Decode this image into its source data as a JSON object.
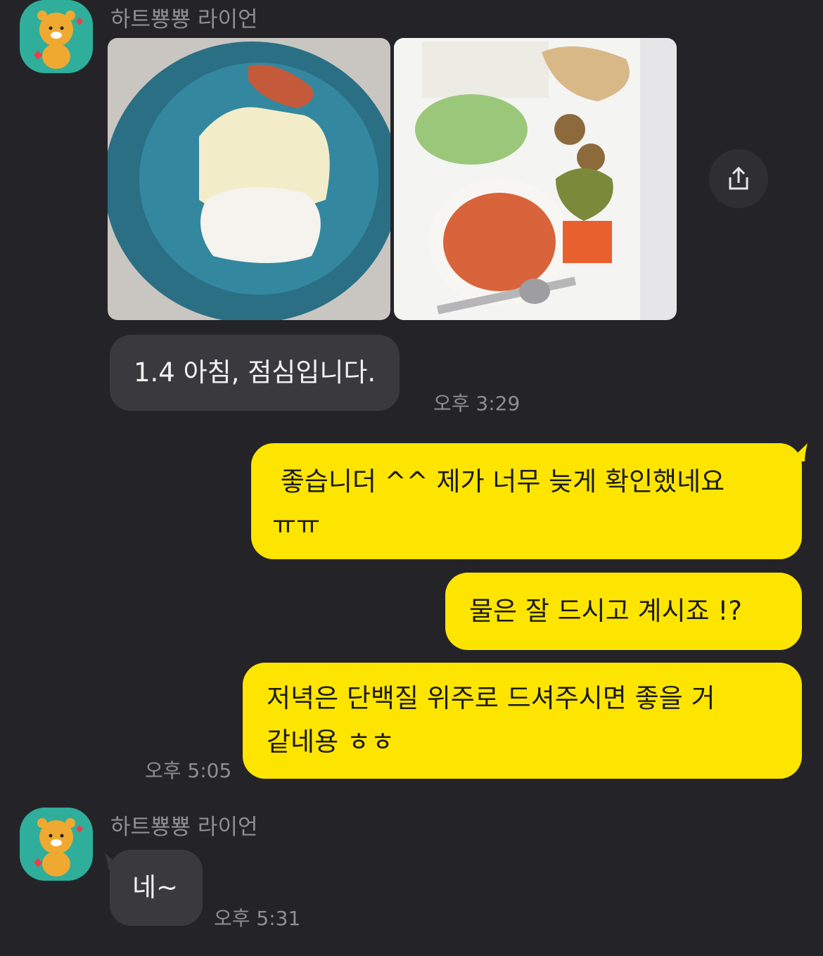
{
  "theme": {
    "background": "#242428",
    "outgoing_bubble": "#fee500",
    "incoming_bubble": "#3a3a3e"
  },
  "messages": [
    {
      "sender": "하트뿅뿅 라이언",
      "photos": [
        {
          "description_icon": "breakfast-photo"
        },
        {
          "description_icon": "lunch-photo"
        }
      ],
      "text": "1.4 아침, 점심입니다.",
      "time": "오후 3:29"
    },
    {
      "outgoing": [
        {
          "line1": " 좋습니더 ^^ 제가 너무 늦게 확인했네요",
          "line2": "ㅠㅠ"
        },
        {
          "text": "물은 잘 드시고 계시죠 !?"
        },
        {
          "line1": "저녁은 단백질 위주로 드셔주시면 좋을 거",
          "line2": "같네용 ㅎㅎ"
        }
      ],
      "time": "오후 5:05"
    },
    {
      "sender": "하트뿅뿅 라이언",
      "text": "네~",
      "time": "오후 5:31"
    }
  ]
}
